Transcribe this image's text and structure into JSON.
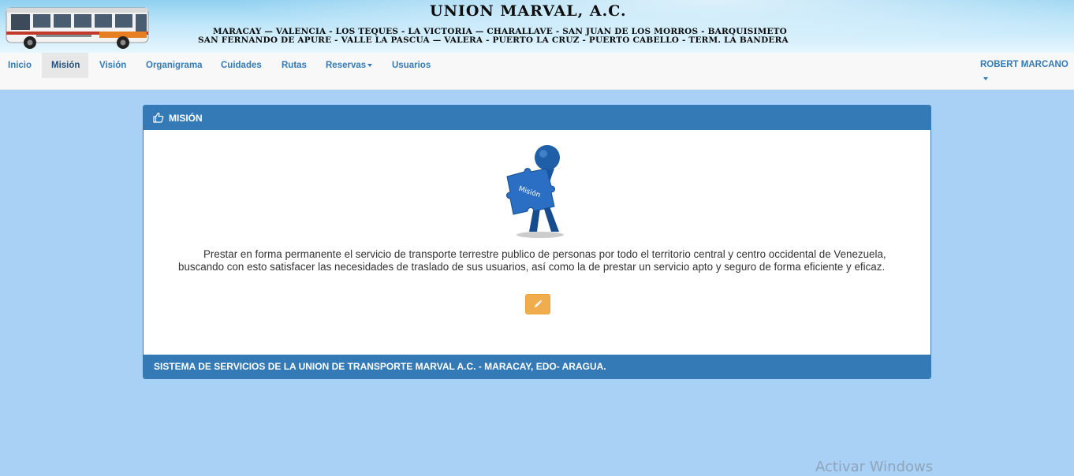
{
  "header": {
    "brand": "UNION MARVAL, A.C.",
    "routes_line1": "MARACAY — VALENCIA - LOS TEQUES - LA VICTORIA — CHARALLAVE - SAN JUAN DE LOS MORROS - BARQUISIMETO",
    "routes_line2": "SAN FERNANDO DE APURE - VALLE  LA PASCUA — VALERA - PUERTO LA CRUZ - PUERTO CABELLO - TERM. LA BANDERA"
  },
  "nav": {
    "items": [
      {
        "label": "Inicio"
      },
      {
        "label": "Misión"
      },
      {
        "label": "Visión"
      },
      {
        "label": "Organigrama"
      },
      {
        "label": "Cuidades"
      },
      {
        "label": "Rutas"
      },
      {
        "label": "Reservas"
      },
      {
        "label": "Usuarios"
      }
    ],
    "active": "Misión",
    "user": "ROBERT MARCANO"
  },
  "panel": {
    "title": "MISIÓN",
    "image_label": "Misión",
    "text": "Prestar en forma permanente el servicio de transporte terrestre publico de personas por todo el territorio central y centro occidental de Venezuela, buscando con esto satisfacer las necesidades de traslado de sus usuarios, así como la de prestar un servicio apto y seguro de forma eficiente y eficaz.",
    "footer": "SISTEMA DE SERVICIOS DE LA UNION DE TRANSPORTE MARVAL A.C. - MARACAY, EDO- ARAGUA."
  },
  "watermark": "Activar Windows",
  "colors": {
    "primary": "#337ab7",
    "warning": "#f0ad4e",
    "background": "#a9d0f5"
  },
  "icons": {
    "panel": "thumbs-up-icon",
    "edit": "pencil-icon"
  }
}
